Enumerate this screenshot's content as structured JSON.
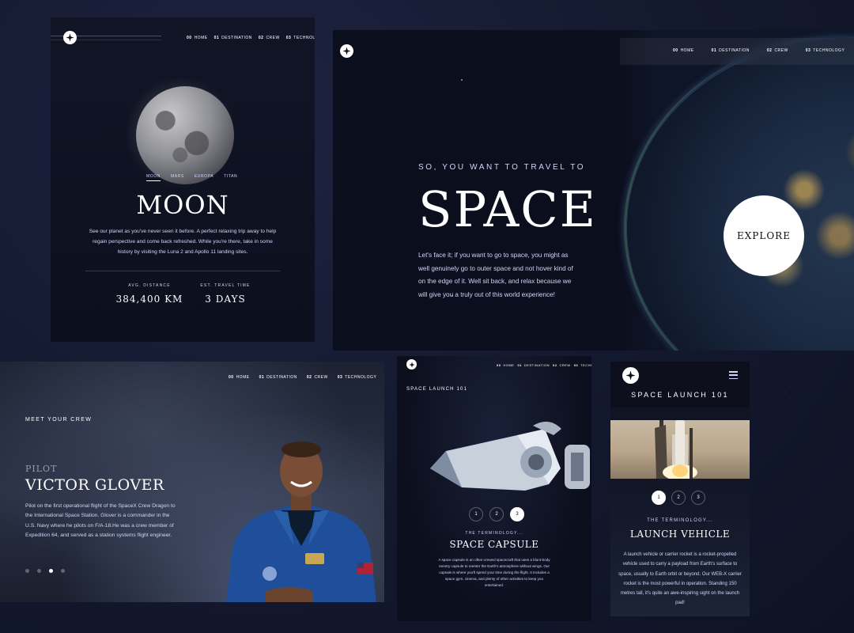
{
  "nav": [
    {
      "num": "00",
      "label": "HOME"
    },
    {
      "num": "01",
      "label": "DESTINATION"
    },
    {
      "num": "02",
      "label": "CREW"
    },
    {
      "num": "03",
      "label": "TECHNOLOGY"
    }
  ],
  "destination": {
    "tabs": [
      "MOON",
      "MARS",
      "EUROPA",
      "TITAN"
    ],
    "title": "MOON",
    "description": "See our planet as you've never seen it before. A perfect relaxing trip away to help regain perspective and come back refreshed. While you're there, take in some history by visiting the Luna 2 and Apollo 11 landing sites.",
    "distance_label": "AVG. DISTANCE",
    "distance_value": "384,400 KM",
    "travel_label": "EST. TRAVEL TIME",
    "travel_value": "3 DAYS"
  },
  "home": {
    "eyebrow": "SO, YOU WANT TO TRAVEL TO",
    "title": "SPACE",
    "description": "Let's face it; if you want to go to space, you might as well genuinely go to outer space and not hover kind of on the edge of it. Well sit back, and relax because we will give you a truly out of this world experience!",
    "cta": "EXPLORE"
  },
  "crew": {
    "eyebrow": "MEET YOUR CREW",
    "role": "PILOT",
    "name": "VICTOR GLOVER",
    "bio": "Pilot on the first operational flight of the SpaceX Crew Dragon to the International Space Station. Glover is a commander in the U.S. Navy where he pilots on F/A-18.He was a crew member of Expedition 64, and served as a station systems flight engineer.",
    "active_index": 2,
    "count": 4
  },
  "technology_tablet": {
    "eyebrow": "SPACE LAUNCH 101",
    "numbers": [
      "1",
      "2",
      "3"
    ],
    "active": 3,
    "term_label": "THE TERMINOLOGY...",
    "title": "SPACE CAPSULE",
    "description": "A space capsule is an often-crewed spacecraft that uses a blunt-body reentry capsule to reenter the Earth's atmosphere without wings. Our capsule is where you'll spend your time during the flight. It includes a space gym, cinema, and plenty of other activities to keep you entertained."
  },
  "technology_mobile": {
    "eyebrow": "SPACE LAUNCH 101",
    "numbers": [
      "1",
      "2",
      "3"
    ],
    "active": 1,
    "term_label": "THE TERMINOLOGY...",
    "title": "LAUNCH VEHICLE",
    "description": "A launch vehicle or carrier rocket is a rocket-propelled vehicle used to carry a payload from Earth's surface to space, usually to Earth orbit or beyond. Our WEB-X carrier rocket is the most powerful in operation. Standing 150 metres tall, it's quite an awe-inspiring sight on the launch pad!"
  },
  "colors": {
    "accent": "#d0d6f9",
    "dark": "#0b0d17",
    "white": "#ffffff"
  }
}
